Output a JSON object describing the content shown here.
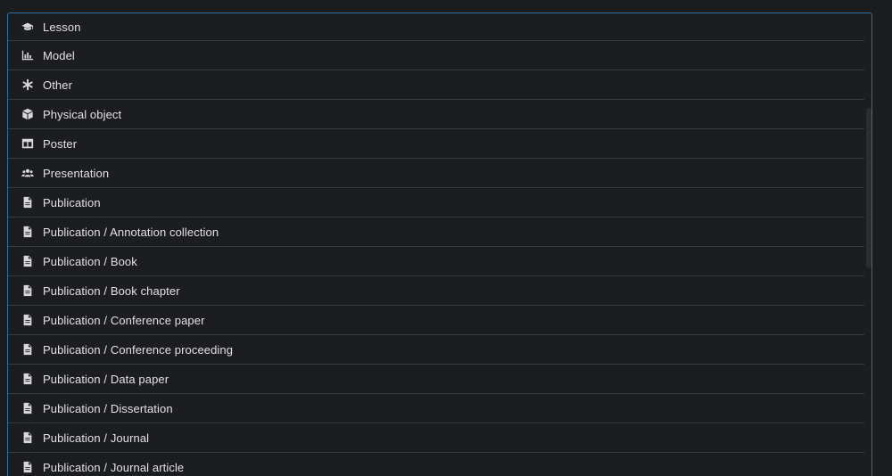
{
  "menu": {
    "items": [
      {
        "label": "Lesson",
        "icon": "graduation-cap-icon"
      },
      {
        "label": "Model",
        "icon": "bar-chart-icon"
      },
      {
        "label": "Other",
        "icon": "asterisk-icon"
      },
      {
        "label": "Physical object",
        "icon": "cube-icon"
      },
      {
        "label": "Poster",
        "icon": "poster-icon"
      },
      {
        "label": "Presentation",
        "icon": "users-icon"
      },
      {
        "label": "Publication",
        "icon": "file-icon"
      },
      {
        "label": "Publication / Annotation collection",
        "icon": "file-icon"
      },
      {
        "label": "Publication / Book",
        "icon": "file-icon"
      },
      {
        "label": "Publication / Book chapter",
        "icon": "file-icon"
      },
      {
        "label": "Publication / Conference paper",
        "icon": "file-icon"
      },
      {
        "label": "Publication / Conference proceeding",
        "icon": "file-icon"
      },
      {
        "label": "Publication / Data paper",
        "icon": "file-icon"
      },
      {
        "label": "Publication / Dissertation",
        "icon": "file-icon"
      },
      {
        "label": "Publication / Journal",
        "icon": "file-icon"
      },
      {
        "label": "Publication / Journal article",
        "icon": "file-icon"
      }
    ]
  },
  "colors": {
    "background": "#1b1c1e",
    "menu_bg": "#1c1d20",
    "divider": "#3a3b3f",
    "text": "#e2e2e2",
    "focus_border": "#2f6fa6"
  }
}
